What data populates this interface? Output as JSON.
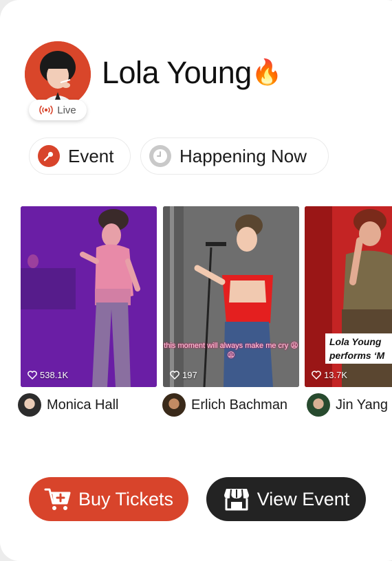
{
  "profile": {
    "name": "Lola Young",
    "emoji": "🔥",
    "live_label": "Live"
  },
  "chips": [
    {
      "label": "Event",
      "icon": "microphone-icon"
    },
    {
      "label": "Happening Now",
      "icon": "clock-icon"
    }
  ],
  "videos": [
    {
      "likes": "538.1K",
      "creator": "Monica Hall",
      "caption": ""
    },
    {
      "likes": "197",
      "creator": "Erlich Bachman",
      "caption": "this moment will always make me cry 😩😩"
    },
    {
      "likes": "13.7K",
      "creator": "Jin Yang",
      "caption": "Lola Young performs ‘M"
    }
  ],
  "actions": {
    "buy_label": "Buy Tickets",
    "view_label": "View Event"
  },
  "colors": {
    "accent": "#d8442b",
    "dark_button": "#232323"
  }
}
